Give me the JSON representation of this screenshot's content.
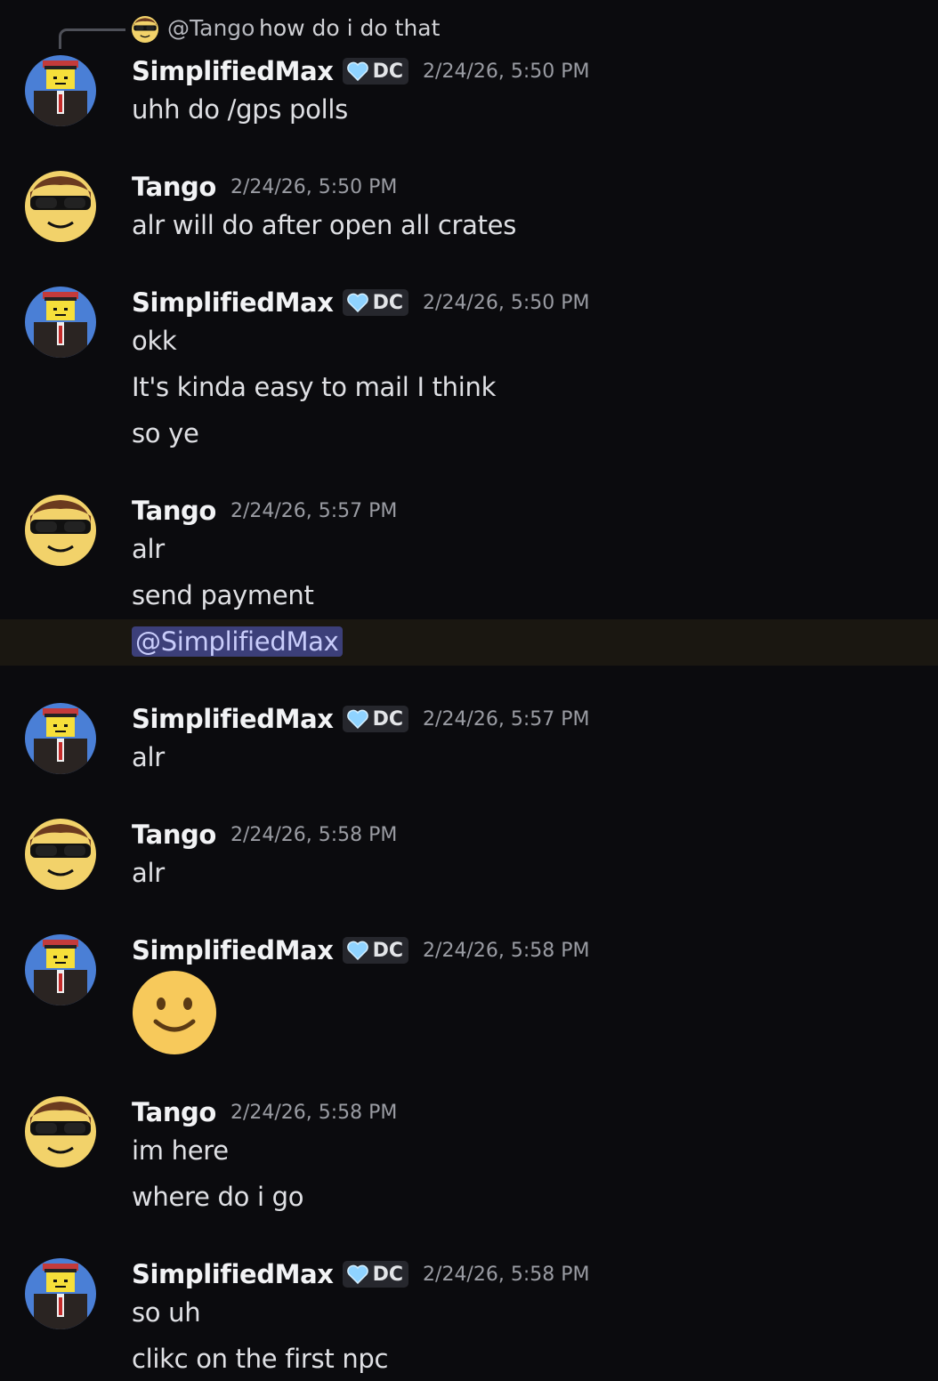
{
  "reply": {
    "name": "@Tango",
    "text": "how do i do that"
  },
  "tag_label": "DC",
  "messages": [
    {
      "user": "SimplifiedMax",
      "timestamp": "2/24/26, 5:50 PM",
      "lines": [
        "uhh do /gps polls"
      ]
    },
    {
      "user": "Tango",
      "timestamp": "2/24/26, 5:50 PM",
      "lines": [
        "alr will do after open all crates"
      ]
    },
    {
      "user": "SimplifiedMax",
      "timestamp": "2/24/26, 5:50 PM",
      "lines": [
        "okk",
        "It's kinda easy to mail I think",
        "so ye"
      ]
    },
    {
      "user": "Tango",
      "timestamp": "2/24/26, 5:57 PM",
      "lines": [
        "alr",
        "send payment"
      ],
      "mention": "@SimplifiedMax"
    },
    {
      "user": "SimplifiedMax",
      "timestamp": "2/24/26, 5:57 PM",
      "lines": [
        "alr"
      ]
    },
    {
      "user": "Tango",
      "timestamp": "2/24/26, 5:58 PM",
      "lines": [
        "alr"
      ]
    },
    {
      "user": "SimplifiedMax",
      "timestamp": "2/24/26, 5:58 PM",
      "lines": [],
      "emoji": "slightly-smiling-face"
    },
    {
      "user": "Tango",
      "timestamp": "2/24/26, 5:58 PM",
      "lines": [
        "im here",
        "where do i go"
      ]
    },
    {
      "user": "SimplifiedMax",
      "timestamp": "2/24/26, 5:58 PM",
      "lines": [
        "so uh",
        "clikc on the first npc"
      ]
    }
  ],
  "colors": {
    "background": "#0b0b0e",
    "mention_bg": "#3c3f79",
    "mention_text": "#c9cdfb",
    "highlight_row": "#1a1711",
    "tag_heart": "#8fd3ff"
  }
}
